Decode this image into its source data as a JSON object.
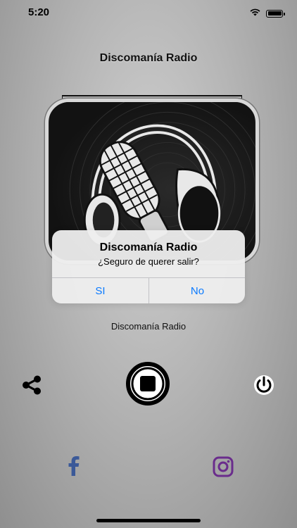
{
  "status_bar": {
    "time": "5:20",
    "icons": [
      "wifi-icon",
      "battery-icon"
    ]
  },
  "app": {
    "title": "Discomanía Radio",
    "station_name": "Discomanía Radio"
  },
  "artwork": {
    "description_icon": "microphone-headphones-logo"
  },
  "alert": {
    "title": "Discomanía Radio",
    "message": "¿Seguro de querer salir?",
    "buttons": [
      "SI",
      "No"
    ],
    "button_color": "#0a7aff"
  },
  "controls": {
    "icons": [
      "share-icon",
      "stop-icon",
      "power-icon"
    ]
  },
  "social": {
    "icons": [
      "facebook-icon",
      "instagram-icon"
    ],
    "colors": {
      "facebook": "#3b5998",
      "instagram": "#6a2c8c"
    }
  }
}
